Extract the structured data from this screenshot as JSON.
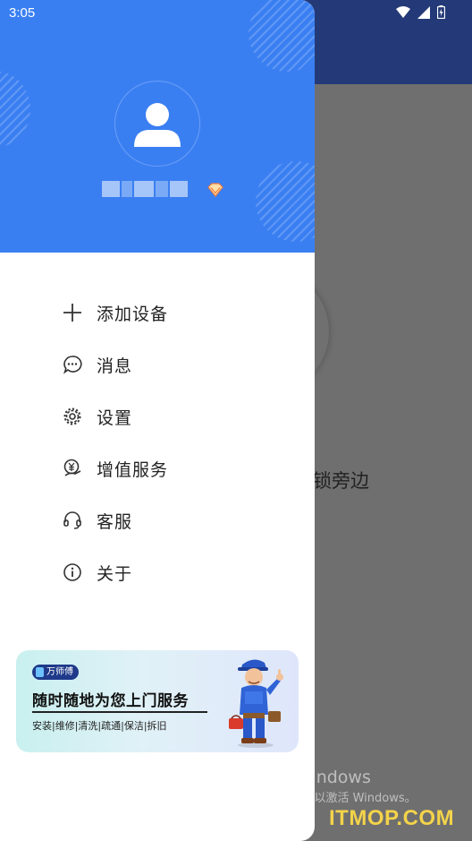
{
  "status_bar": {
    "time": "3:05"
  },
  "background": {
    "fragment_text": "锁旁边"
  },
  "drawer": {
    "menu": [
      {
        "label": "添加设备",
        "icon": "plus-icon"
      },
      {
        "label": "消息",
        "icon": "message-icon"
      },
      {
        "label": "设置",
        "icon": "gear-icon"
      },
      {
        "label": "增值服务",
        "icon": "yuan-service-icon"
      },
      {
        "label": "客服",
        "icon": "headset-icon"
      },
      {
        "label": "关于",
        "icon": "info-icon"
      }
    ],
    "banner": {
      "brand": "万师傅",
      "headline": "随时随地为您上门服务",
      "services": "安装|维修|清洗|疏通|保洁|拆旧"
    }
  },
  "watermark": {
    "line1": "激活 Windows",
    "line2": "转到“设置”以激活 Windows。",
    "site": "ITMOP.COM"
  },
  "colors": {
    "header_blue": "#3a7ff2",
    "topbar_navy": "#243a78",
    "scrim": "#6f6f6f",
    "site_yellow": "#f3d34a"
  }
}
